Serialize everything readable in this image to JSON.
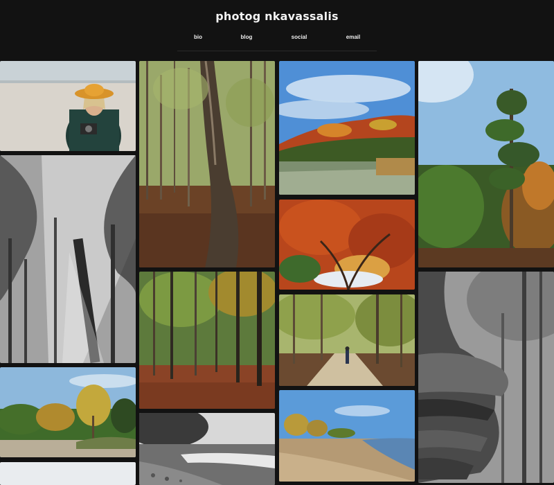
{
  "site": {
    "title": "photog nkavassalis"
  },
  "nav": [
    {
      "label": "bio"
    },
    {
      "label": "blog"
    },
    {
      "label": "social"
    },
    {
      "label": "email"
    }
  ],
  "colors": {
    "background": "#121212",
    "text": "#f2f2f2"
  }
}
